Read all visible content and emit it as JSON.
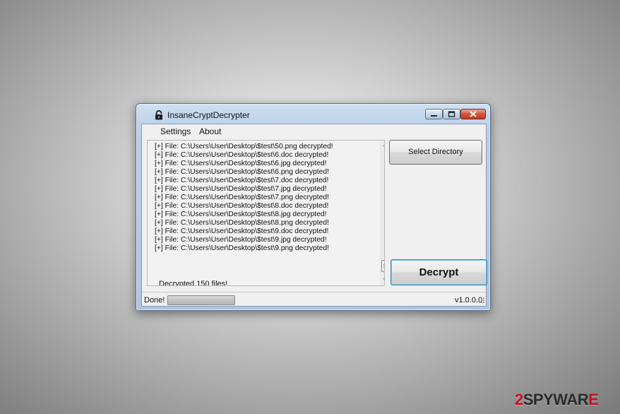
{
  "window": {
    "title": "InsaneCryptDecrypter"
  },
  "menu": {
    "items": [
      {
        "label": "Settings"
      },
      {
        "label": "About"
      }
    ]
  },
  "log": {
    "lines": [
      "[+] File: C:\\Users\\User\\Desktop\\$test\\50.png decrypted!",
      "[+] File: C:\\Users\\User\\Desktop\\$test\\6.doc decrypted!",
      "[+] File: C:\\Users\\User\\Desktop\\$test\\6.jpg decrypted!",
      "[+] File: C:\\Users\\User\\Desktop\\$test\\6.png decrypted!",
      "[+] File: C:\\Users\\User\\Desktop\\$test\\7.doc decrypted!",
      "[+] File: C:\\Users\\User\\Desktop\\$test\\7.jpg decrypted!",
      "[+] File: C:\\Users\\User\\Desktop\\$test\\7.png decrypted!",
      "[+] File: C:\\Users\\User\\Desktop\\$test\\8.doc decrypted!",
      "[+] File: C:\\Users\\User\\Desktop\\$test\\8.jpg decrypted!",
      "[+] File: C:\\Users\\User\\Desktop\\$test\\8.png decrypted!",
      "[+] File: C:\\Users\\User\\Desktop\\$test\\9.doc decrypted!",
      "[+] File: C:\\Users\\User\\Desktop\\$test\\9.jpg decrypted!",
      "[+] File: C:\\Users\\User\\Desktop\\$test\\9.png decrypted!"
    ],
    "summary": "Decrypted 150 files!"
  },
  "buttons": {
    "select_directory": "Select Directory",
    "decrypt": "Decrypt"
  },
  "statusbar": {
    "status": "Done!",
    "progress": 1.0,
    "version": "v1.0.0.0"
  },
  "watermark": {
    "digit": "2",
    "text": "SPYWAR",
    "accent_letter": "E"
  },
  "colors": {
    "close_button": "#c23c24",
    "decrypt_focus": "#3c7fb1",
    "watermark_accent": "#c8101e"
  }
}
